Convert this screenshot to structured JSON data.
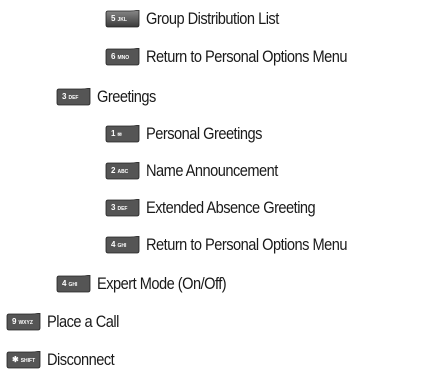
{
  "items": [
    {
      "key": "5",
      "sub": "JKL",
      "label": "Group Distribution List",
      "icon": "key-5-icon"
    },
    {
      "key": "6",
      "sub": "MNO",
      "label": "Return to Personal Options Menu",
      "icon": "key-6-icon"
    },
    {
      "key": "3",
      "sub": "DEF",
      "label": "Greetings",
      "icon": "key-3-icon"
    },
    {
      "key": "1",
      "sub": "✉",
      "label": "Personal Greetings",
      "icon": "key-1-icon"
    },
    {
      "key": "2",
      "sub": "ABC",
      "label": "Name Announcement",
      "icon": "key-2-icon"
    },
    {
      "key": "3",
      "sub": "DEF",
      "label": "Extended Absence Greeting",
      "icon": "key-3-icon"
    },
    {
      "key": "4",
      "sub": "GHI",
      "label": "Return to Personal Options Menu",
      "icon": "key-4-icon"
    },
    {
      "key": "4",
      "sub": "GHI",
      "label": "Expert Mode (On/Off)",
      "icon": "key-4-icon"
    },
    {
      "key": "9",
      "sub": "WXYZ",
      "label": "Place a Call",
      "icon": "key-9-icon"
    },
    {
      "key": "✱",
      "sub": "SHIFT",
      "label": "Disconnect",
      "icon": "key-star-icon"
    }
  ]
}
